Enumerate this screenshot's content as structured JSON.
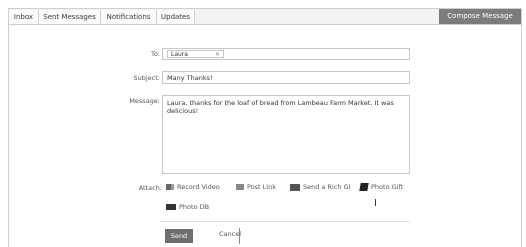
{
  "tabs": [
    "Inbox",
    "Sent Messages",
    "Notifications",
    "Updates"
  ],
  "compose_button": "Compose Message",
  "form": {
    "to_label": "To:",
    "to_chip": "Laura",
    "to_chip_remove": "×",
    "subject_label": "Subject:",
    "subject_value": "Many Thanks!",
    "message_label": "Message:",
    "message_value": "Laura, thanks for the loaf of bread from Lambeau Farm Market. It was delicious!",
    "attach_label": "Attach:",
    "attach_items": [
      "Record Video",
      "Post Link",
      "Send a Rich GI",
      "Photo Gift",
      "Photo DB"
    ]
  },
  "actions": {
    "send": "Send",
    "cancel": "Cancel"
  }
}
